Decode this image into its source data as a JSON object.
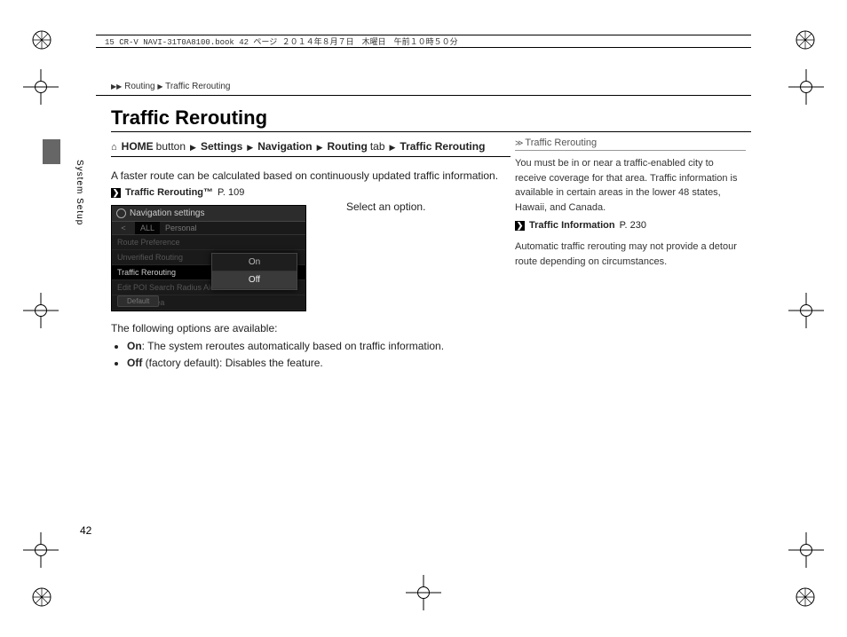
{
  "header": {
    "text": "15 CR-V NAVI-31T0A8100.book  42 ページ  ２０１４年８月７日　木曜日　午前１０時５０分"
  },
  "breadcrumb": {
    "a": "Routing",
    "b": "Traffic Rerouting"
  },
  "title": "Traffic Rerouting",
  "sideLabel": "System Setup",
  "nav": {
    "home": "HOME",
    "button": "button",
    "settings": "Settings",
    "navigation": "Navigation",
    "routing": "Routing",
    "tab": "tab",
    "traffic": "Traffic Rerouting"
  },
  "intro": "A faster route can be calculated based on continuously updated traffic information.",
  "ref1": {
    "label": "Traffic Rerouting™",
    "page": "P. 109"
  },
  "screenshot": {
    "title": "Navigation settings",
    "tabs": {
      "all": "ALL",
      "personal": "Personal"
    },
    "rows": {
      "r1": "Route Preference",
      "r2": "Unverified Routing",
      "r3": "Traffic Rerouting",
      "r4": "Edit POI Search Radius Alo",
      "r5": "Avoided Area"
    },
    "popup": {
      "on": "On",
      "off": "Off"
    },
    "default": "Default"
  },
  "selectLabel": "Select an option.",
  "optionsHeader": "The following options are available:",
  "options": {
    "on": {
      "name": "On",
      "desc": ": The system reroutes automatically based on traffic information."
    },
    "off": {
      "name": "Off",
      "desc": " (factory default): Disables the feature."
    }
  },
  "sidebar": {
    "title": "Traffic Rerouting",
    "body1": "You must be in or near a traffic-enabled city to receive coverage for that area. Traffic information is available in certain areas in the lower 48 states, Hawaii, and Canada.",
    "ref": {
      "label": "Traffic Information",
      "page": "P. 230"
    },
    "body2": "Automatic traffic rerouting may not provide a detour route depending on circumstances."
  },
  "pageNumber": "42"
}
